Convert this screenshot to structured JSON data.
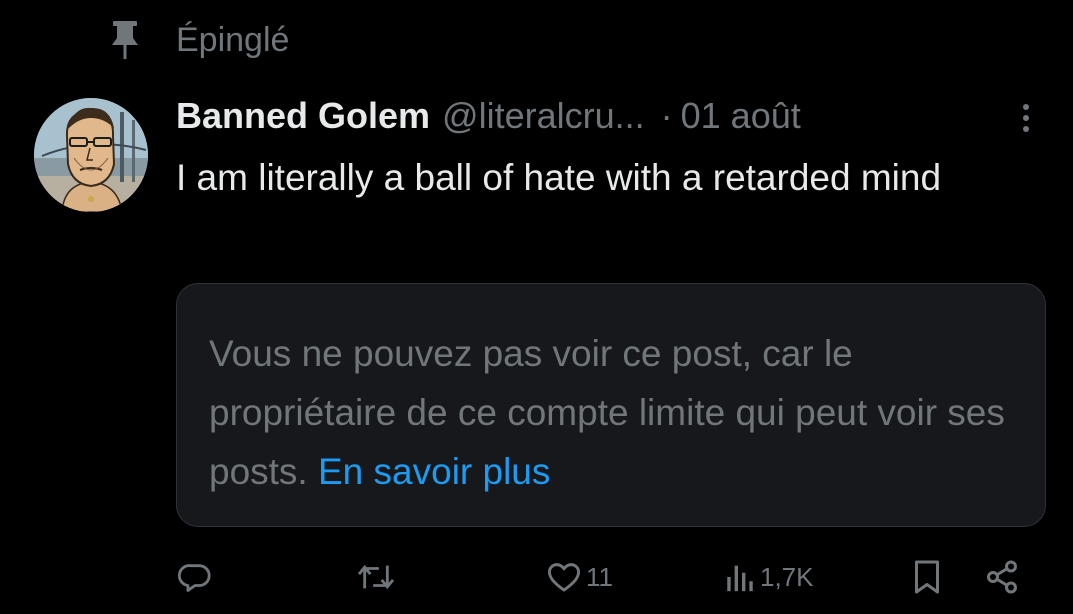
{
  "pinned": {
    "label": "Épinglé",
    "icon": "pin-icon"
  },
  "post": {
    "author_name": "Banned Golem",
    "author_handle": "@literalcru...",
    "separator": "·",
    "date": "01 août",
    "text": "I am literally a ball of hate with a retarded mind",
    "avatar_icon": "avatar",
    "more_icon": "more-vertical-icon"
  },
  "notice": {
    "text": "Vous ne pouvez pas voir ce post, car le propriétaire de ce compte limite qui peut voir ses posts.",
    "link": "En savoir plus"
  },
  "actions": {
    "reply": {
      "icon": "reply-icon",
      "count": ""
    },
    "repost": {
      "icon": "repost-icon",
      "count": ""
    },
    "like": {
      "icon": "heart-icon",
      "count": "11"
    },
    "views": {
      "icon": "views-icon",
      "count": "1,7K"
    },
    "bookmark": {
      "icon": "bookmark-icon"
    },
    "share": {
      "icon": "share-icon"
    }
  },
  "colors": {
    "background": "#000000",
    "text_primary": "#e7e9ea",
    "text_secondary": "#71767b",
    "link": "#1d9bf0",
    "notice_background": "#16181c",
    "notice_border": "#2f3336"
  }
}
